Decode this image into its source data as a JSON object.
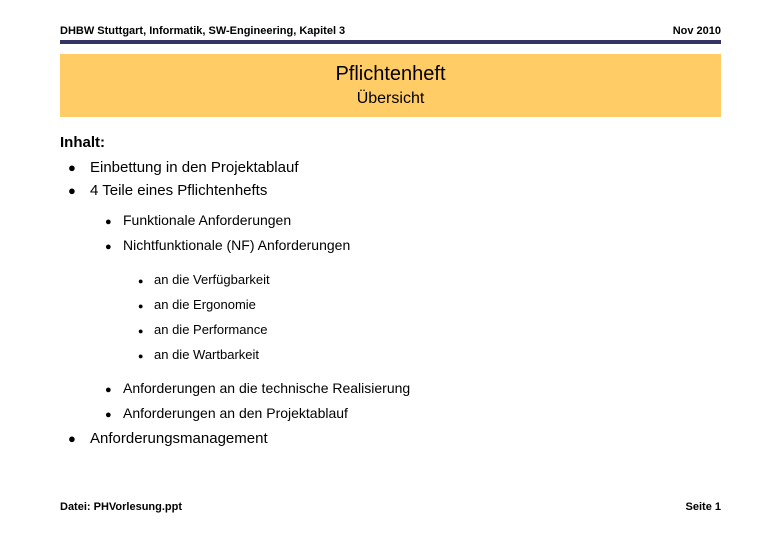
{
  "header": {
    "left": "DHBW Stuttgart, Informatik, SW-Engineering, Kapitel 3",
    "right": "Nov 2010",
    "rule_color": "#333366"
  },
  "banner": {
    "title": "Pflichtenheft",
    "subtitle": "Übersicht",
    "background_color": "#FFCC66"
  },
  "content": {
    "heading": "Inhalt:",
    "bullets": [
      {
        "level": 1,
        "marker": "●",
        "text": "Einbettung in den Projektablauf"
      },
      {
        "level": 1,
        "marker": "●",
        "text": "4 Teile eines Pflichtenhefts"
      },
      {
        "level": 2,
        "marker": "●",
        "text": "Funktionale Anforderungen"
      },
      {
        "level": 2,
        "marker": "●",
        "text": "Nichtfunktionale (NF) Anforderungen"
      },
      {
        "level": 3,
        "marker": "●",
        "text": "an die Verfügbarkeit"
      },
      {
        "level": 3,
        "marker": "●",
        "text": "an die Ergonomie"
      },
      {
        "level": 3,
        "marker": "●",
        "text": "an die Performance"
      },
      {
        "level": 3,
        "marker": "●",
        "text": "an die Wartbarkeit"
      },
      {
        "level": 2,
        "marker": "●",
        "text": "Anforderungen an die technische Realisierung"
      },
      {
        "level": 2,
        "marker": "●",
        "text": "Anforderungen an den Projektablauf"
      },
      {
        "level": 1,
        "marker": "●",
        "text": "Anforderungsmanagement"
      }
    ]
  },
  "footer": {
    "left": "Datei: PHVorlesung.ppt",
    "right": "Seite 1"
  }
}
